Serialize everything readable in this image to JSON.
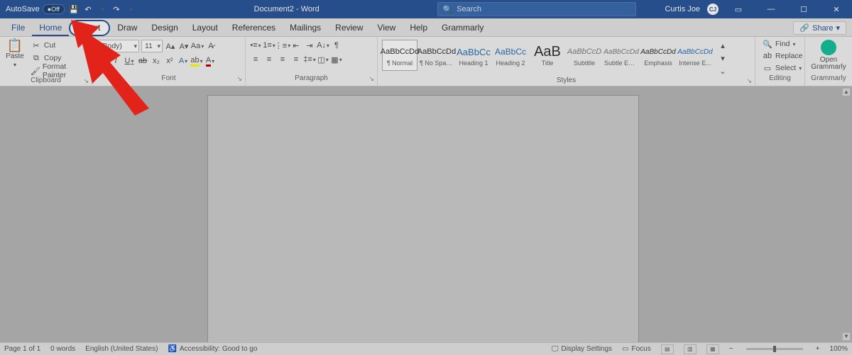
{
  "titlebar": {
    "autosave_label": "AutoSave",
    "autosave_state": "Off",
    "doc_title": "Document2 - Word",
    "search_placeholder": "Search",
    "user_name": "Curtis Joe"
  },
  "tabs": {
    "file": "File",
    "home": "Home",
    "insert": "Insert",
    "draw": "Draw",
    "design": "Design",
    "layout": "Layout",
    "references": "References",
    "mailings": "Mailings",
    "review": "Review",
    "view": "View",
    "help": "Help",
    "grammarly": "Grammarly",
    "share": "Share"
  },
  "ribbon": {
    "clipboard": {
      "paste": "Paste",
      "cut": "Cut",
      "copy": "Copy",
      "format_painter": "Format Painter",
      "group_label": "Clipboard"
    },
    "font": {
      "font_name": "(Body)",
      "font_size": "11",
      "group_label": "Font"
    },
    "paragraph": {
      "group_label": "Paragraph"
    },
    "styles": {
      "group_label": "Styles",
      "items": [
        {
          "preview": "AaBbCcDd",
          "name": "¶ Normal",
          "color": "#333",
          "size": "11px",
          "selected": true
        },
        {
          "preview": "AaBbCcDd",
          "name": "¶ No Spac...",
          "color": "#333",
          "size": "11px"
        },
        {
          "preview": "AaBbCc",
          "name": "Heading 1",
          "color": "#2e74b5",
          "size": "13px"
        },
        {
          "preview": "AaBbCc",
          "name": "Heading 2",
          "color": "#2e74b5",
          "size": "12px"
        },
        {
          "preview": "AaB",
          "name": "Title",
          "color": "#333",
          "size": "20px"
        },
        {
          "preview": "AaBbCcD",
          "name": "Subtitle",
          "color": "#808080",
          "size": "11px",
          "italic": true
        },
        {
          "preview": "AaBbCcDd",
          "name": "Subtle Em...",
          "color": "#808080",
          "size": "10px",
          "italic": true
        },
        {
          "preview": "AaBbCcDd",
          "name": "Emphasis",
          "color": "#333",
          "size": "10px",
          "italic": true
        },
        {
          "preview": "AaBbCcDd",
          "name": "Intense E...",
          "color": "#2e74b5",
          "size": "10px",
          "italic": true
        }
      ]
    },
    "editing": {
      "find": "Find",
      "replace": "Replace",
      "select": "Select",
      "group_label": "Editing"
    },
    "grammarly": {
      "open": "Open Grammarly",
      "group_label": "Grammarly"
    }
  },
  "statusbar": {
    "page": "Page 1 of 1",
    "words": "0 words",
    "language": "English (United States)",
    "accessibility": "Accessibility: Good to go",
    "display_settings": "Display Settings",
    "focus": "Focus",
    "zoom": "100%"
  }
}
